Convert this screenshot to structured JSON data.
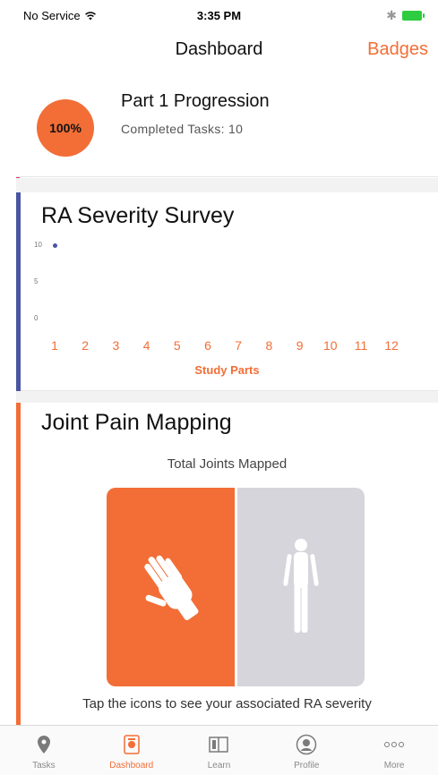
{
  "colors": {
    "accent": "#f26e36",
    "survey_bar": "#4a55a2",
    "tab_inactive": "#7a7a7a",
    "tab_inactive_label": "#8a8a8a",
    "body_gray": "#d6d5dc",
    "battery": "#2ecc40"
  },
  "status_bar": {
    "carrier": "No Service",
    "time": "3:35 PM"
  },
  "nav": {
    "title": "Dashboard",
    "right_button": "Badges"
  },
  "progress": {
    "percent_label": "100%",
    "percent": 100,
    "title": "Part 1 Progression",
    "subtitle": "Completed Tasks: 10"
  },
  "survey": {
    "title": "RA Severity Survey"
  },
  "chart_data": {
    "type": "scatter",
    "title": "RA Severity Survey",
    "xlabel": "Study Parts",
    "ylabel": "",
    "x_ticks": [
      "1",
      "2",
      "3",
      "4",
      "5",
      "6",
      "7",
      "8",
      "9",
      "10",
      "11",
      "12"
    ],
    "y_ticks": [
      "10",
      "5",
      "0"
    ],
    "ylim": [
      0,
      10
    ],
    "series": [
      {
        "points": [
          {
            "x": 1,
            "y": 10
          }
        ]
      }
    ]
  },
  "joint": {
    "title": "Joint Pain Mapping",
    "subtitle": "Total Joints Mapped",
    "hint": "Tap the icons to see your associated RA severity"
  },
  "tabs": [
    {
      "label": "Tasks",
      "icon": "location-pin-icon",
      "active": false
    },
    {
      "label": "Dashboard",
      "icon": "dashboard-icon",
      "active": true
    },
    {
      "label": "Learn",
      "icon": "book-icon",
      "active": false
    },
    {
      "label": "Profile",
      "icon": "profile-icon",
      "active": false
    },
    {
      "label": "More",
      "icon": "more-icon",
      "active": false
    }
  ]
}
